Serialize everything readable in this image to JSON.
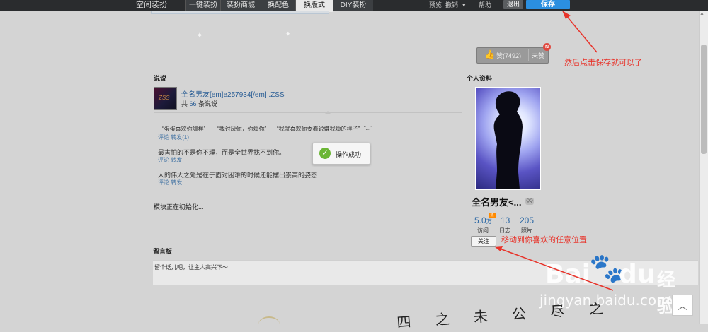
{
  "topbar": {
    "title": "空间装扮",
    "tabs": [
      "一键装扮",
      "装扮商城",
      "换配色",
      "换版式",
      "DIY装扮"
    ],
    "active_tab": "换版式",
    "preview": "预览",
    "undo": "撤销",
    "undo_caret": "▾",
    "help": "帮助",
    "exit": "退出",
    "save": "保存"
  },
  "like": {
    "label": "赞(7492)",
    "unlike": "未赞",
    "badge": "N"
  },
  "annotations": {
    "save_hint": "然后点击保存就可以了",
    "move_hint": "移动到你喜欢的任意位置"
  },
  "shuoshuo": {
    "header": "说说",
    "avatar_text": "ZSS",
    "user_name": "全名男友[em]e257934[/em] .ZSS",
    "count_prefix": "共",
    "count": "66",
    "count_suffix": "条说说",
    "quotes": [
      "“蛋蛋喜欢你哪样”",
      "“我讨厌你，你烦你”",
      "“我就喜欢你委着说嫌我烦的样子”",
      "“...”"
    ],
    "posts": [
      {
        "text": "最害怕的不是你不理，而是全世界找不到你。",
        "actions": "评论 转发"
      },
      {
        "text": "人的伟大之处是在于面对困难的时候还能摆出崇高的姿态",
        "actions": "评论 转发"
      }
    ],
    "first_actions": "评论 转发(1)"
  },
  "toast": {
    "icon": "✓",
    "message": "操作成功"
  },
  "module_init": "模块正在初始化...",
  "profile": {
    "header": "个人资料",
    "name": "全名男友<...",
    "verify": "QQ",
    "stats": [
      {
        "value": "5.0",
        "unit": "万",
        "label": "访问"
      },
      {
        "value": "13",
        "unit": "",
        "label": "日志"
      },
      {
        "value": "205",
        "unit": "",
        "label": "照片"
      }
    ],
    "hot_badge": "热",
    "follow": "关注"
  },
  "guestbook": {
    "header": "留言板",
    "placeholder": "留个话儿吧，让主人高兴下～"
  },
  "signature": "四 之 未 公 尽 之",
  "watermark": {
    "bai": "Bai",
    "paw": "🐾",
    "du": "du",
    "jingyan": "经验",
    "url": "jingyan.baidu.com"
  },
  "totop_icon": "︿",
  "colors": {
    "accent": "#2b8fe0",
    "annotation": "#e8332a",
    "link": "#2c5f96"
  }
}
